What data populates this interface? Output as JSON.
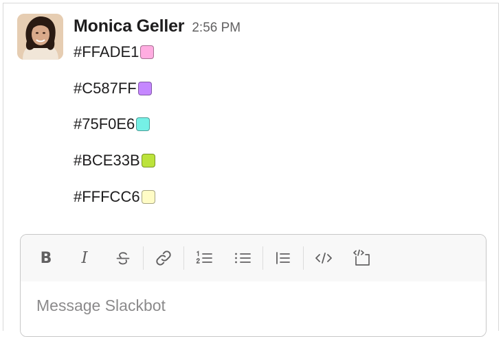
{
  "message": {
    "author": "Monica Geller",
    "time": "2:56 PM",
    "colors": [
      {
        "hex": "#FFADE1",
        "swatch": "#FFADE1"
      },
      {
        "hex": "#C587FF",
        "swatch": "#C587FF"
      },
      {
        "hex": "#75F0E6",
        "swatch": "#75F0E6"
      },
      {
        "hex": "#BCE33B",
        "swatch": "#BCE33B"
      },
      {
        "hex": "#FFFCC6",
        "swatch": "#FFFCC6"
      }
    ]
  },
  "composer": {
    "placeholder": "Message Slackbot",
    "toolbar": [
      "bold-icon",
      "italic-icon",
      "strikethrough-icon",
      "link-icon",
      "ordered-list-icon",
      "bulleted-list-icon",
      "blockquote-icon",
      "code-icon",
      "code-block-icon"
    ]
  }
}
